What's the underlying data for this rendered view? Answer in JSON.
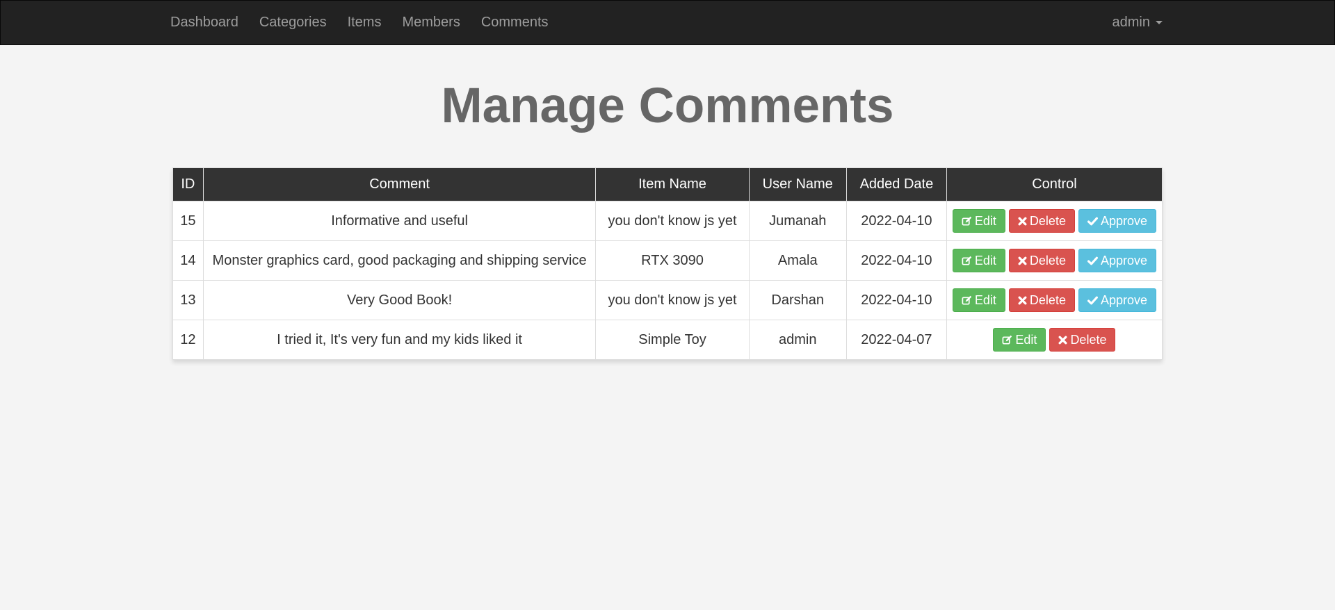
{
  "navbar": {
    "links": [
      "Dashboard",
      "Categories",
      "Items",
      "Members",
      "Comments"
    ],
    "user": "admin"
  },
  "page_title": "Manage Comments",
  "table": {
    "headers": [
      "ID",
      "Comment",
      "Item Name",
      "User Name",
      "Added Date",
      "Control"
    ],
    "rows": [
      {
        "id": "15",
        "comment": "Informative and useful",
        "item": "you don't know js yet",
        "user": "Jumanah",
        "date": "2022-04-10",
        "approved": false
      },
      {
        "id": "14",
        "comment": "Monster graphics card, good packaging and shipping service",
        "item": "RTX 3090",
        "user": "Amala",
        "date": "2022-04-10",
        "approved": false
      },
      {
        "id": "13",
        "comment": "Very Good Book!",
        "item": "you don't know js yet",
        "user": "Darshan",
        "date": "2022-04-10",
        "approved": false
      },
      {
        "id": "12",
        "comment": "I tried it, It's very fun and my kids liked it",
        "item": "Simple Toy",
        "user": "admin",
        "date": "2022-04-07",
        "approved": true
      }
    ]
  },
  "buttons": {
    "edit": "Edit",
    "delete": "Delete",
    "approve": "Approve"
  },
  "icons": {
    "edit": "edit-icon",
    "delete": "close-icon",
    "approve": "check-icon"
  },
  "colors": {
    "navbar": "#222222",
    "edit": "#5cb85c",
    "delete": "#d9534f",
    "approve": "#5bc0de"
  }
}
